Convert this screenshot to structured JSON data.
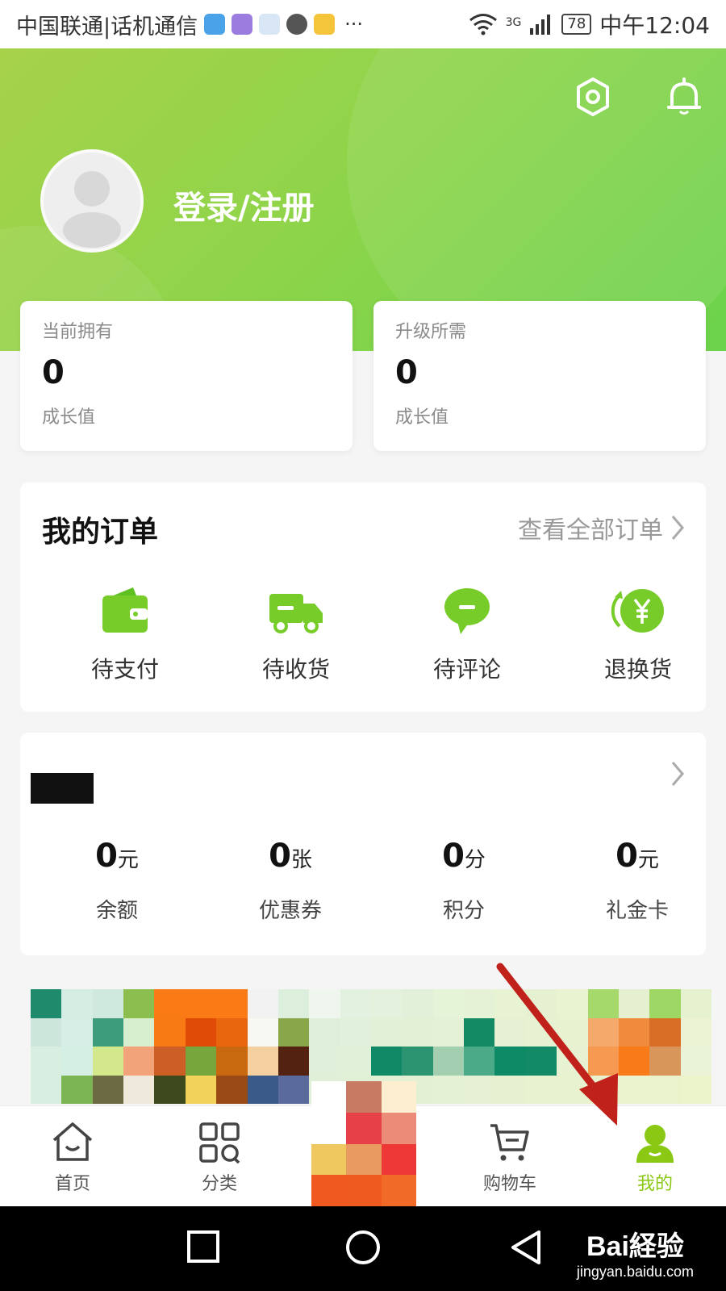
{
  "status_bar": {
    "carrier": "中国联通|话机通信",
    "dots": "···",
    "network": "3G",
    "battery": "78",
    "time": "中午12:04"
  },
  "header": {
    "login_text": "登录/注册",
    "icons": [
      "settings-icon",
      "bell-icon"
    ]
  },
  "growth": {
    "current": {
      "label": "当前拥有",
      "value": "0",
      "unit": "成长值"
    },
    "upgrade": {
      "label": "升级所需",
      "value": "0",
      "unit": "成长值"
    }
  },
  "orders": {
    "title": "我的订单",
    "view_all": "查看全部订单",
    "items": [
      {
        "label": "待支付",
        "icon": "wallet-icon"
      },
      {
        "label": "待收货",
        "icon": "truck-icon"
      },
      {
        "label": "待评论",
        "icon": "comment-icon"
      },
      {
        "label": "退换货",
        "icon": "refund-icon"
      }
    ]
  },
  "wallet": {
    "items": [
      {
        "value": "0",
        "unit": "元",
        "label": "余额"
      },
      {
        "value": "0",
        "unit": "张",
        "label": "优惠券"
      },
      {
        "value": "0",
        "unit": "分",
        "label": "积分"
      },
      {
        "value": "0",
        "unit": "元",
        "label": "礼金卡"
      }
    ]
  },
  "tabbar": {
    "items": [
      {
        "label": "首页",
        "icon": "home-icon"
      },
      {
        "label": "分类",
        "icon": "category-icon"
      },
      {
        "label": "购物车",
        "icon": "cart-icon"
      },
      {
        "label": "我的",
        "icon": "profile-icon",
        "active": true
      }
    ]
  },
  "watermark": {
    "brand": "Bai経验",
    "url": "jingyan.baidu.com"
  },
  "colors": {
    "accent": "#8bc814",
    "header_start": "#a6d24a",
    "header_end": "#6cd34c",
    "arrow": "#c0211a"
  }
}
